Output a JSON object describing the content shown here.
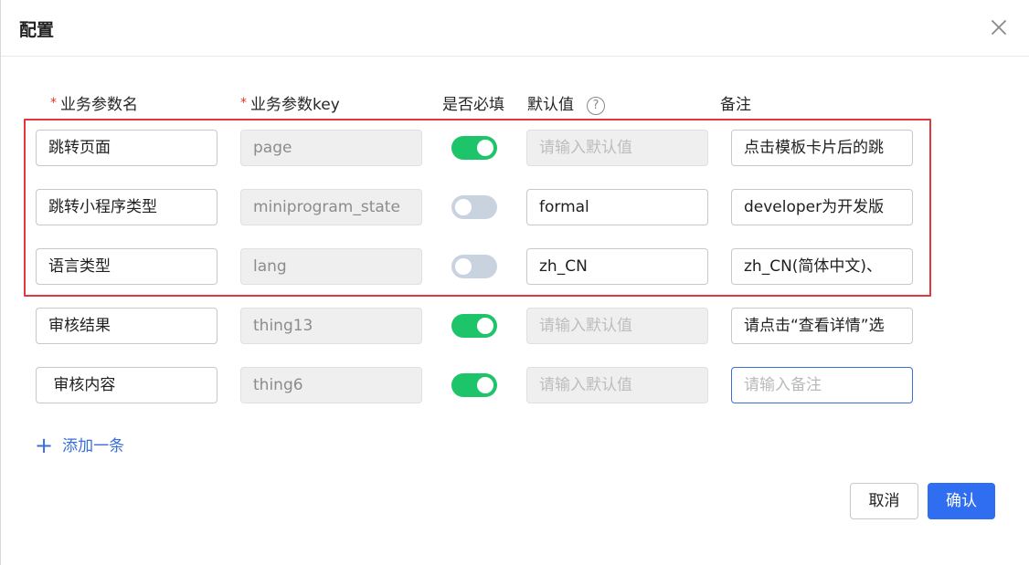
{
  "dialog": {
    "title": "配置",
    "close_icon": "close-icon"
  },
  "columns": {
    "name": "业务参数名",
    "key": "业务参数key",
    "required": "是否必填",
    "default": "默认值",
    "remark": "备注",
    "required_marker": "*",
    "help_icon": "question-circle-icon",
    "help_glyph": "?"
  },
  "rows": [
    {
      "name": "跳转页面",
      "key": "page",
      "required": true,
      "default": "",
      "default_placeholder": "请输入默认值",
      "remark": "点击模板卡片后的跳",
      "remark_placeholder": "请输入备注"
    },
    {
      "name": "跳转小程序类型",
      "key": "miniprogram_state",
      "required": false,
      "default": "formal",
      "default_placeholder": "请输入默认值",
      "remark": "developer为开发版",
      "remark_placeholder": "请输入备注"
    },
    {
      "name": "语言类型",
      "key": "lang",
      "required": false,
      "default": "zh_CN",
      "default_placeholder": "请输入默认值",
      "remark": "zh_CN(简体中文)、",
      "remark_placeholder": "请输入备注"
    },
    {
      "name": "审核结果",
      "key": "thing13",
      "required": true,
      "default": "",
      "default_placeholder": "请输入默认值",
      "remark": "请点击“查看详情”选",
      "remark_placeholder": "请输入备注"
    },
    {
      "name": " 审核内容",
      "key": "thing6",
      "required": true,
      "default": "",
      "default_placeholder": "请输入默认值",
      "remark": "",
      "remark_placeholder": "请输入备注"
    }
  ],
  "add_row": {
    "label": "添加一条",
    "icon": "plus-icon",
    "glyph": "+"
  },
  "footer": {
    "cancel_label": "取消",
    "confirm_label": "确认"
  },
  "colors": {
    "accent": "#2f6ef0",
    "toggle_on": "#1ec46a",
    "toggle_off": "#c9d3e0",
    "required_star": "#e5332a",
    "highlight_box": "#e0383c"
  }
}
